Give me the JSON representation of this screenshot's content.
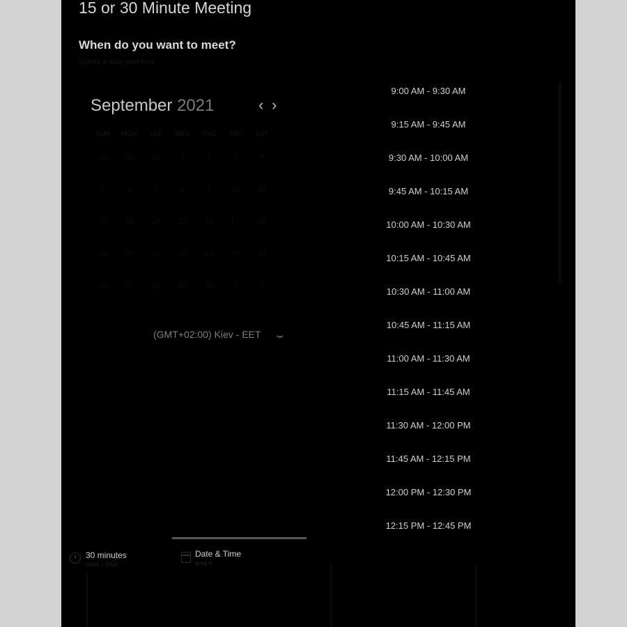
{
  "header": {
    "title": "15 or 30 Minute Meeting",
    "heading": "When do you want to meet?",
    "subheading": "Select a date and time"
  },
  "calendar": {
    "month": "September",
    "year": "2021",
    "prev_icon": "chevron-left-icon",
    "next_icon": "chevron-right-icon",
    "weekdays": [
      "SUN",
      "MON",
      "TUE",
      "WED",
      "THU",
      "FRI",
      "SAT"
    ],
    "days": [
      "29",
      "30",
      "31",
      "1",
      "2",
      "3",
      "4",
      "5",
      "6",
      "7",
      "8",
      "9",
      "10",
      "11",
      "12",
      "13",
      "14",
      "15",
      "16",
      "17",
      "18",
      "19",
      "20",
      "21",
      "22",
      "23",
      "24",
      "25",
      "26",
      "27",
      "28",
      "29",
      "30",
      "1",
      "2"
    ]
  },
  "timezone": {
    "label": "(GMT+02:00) Kiev - EET",
    "icon": "chevron-down-icon"
  },
  "slots": [
    "9:00 AM - 9:30 AM",
    "9:15 AM - 9:45 AM",
    "9:30 AM - 10:00 AM",
    "9:45 AM - 10:15 AM",
    "10:00 AM - 10:30 AM",
    "10:15 AM - 10:45 AM",
    "10:30 AM - 11:00 AM",
    "10:45 AM - 11:15 AM",
    "11:00 AM - 11:30 AM",
    "11:15 AM - 11:45 AM",
    "11:30 AM - 12:00 PM",
    "11:45 AM - 12:15 PM",
    "12:00 PM - 12:30 PM",
    "12:15 PM - 12:45 PM"
  ],
  "steps": {
    "duration": {
      "label": "30 minutes",
      "sub": "HOW LONG",
      "icon": "clock-icon"
    },
    "datetime": {
      "label": "Date & Time",
      "sub": "WHEN",
      "icon": "calendar-icon"
    }
  },
  "colors": {
    "background": "#000000",
    "outer": "#d3d3d3",
    "text": "#cfcfcf"
  }
}
